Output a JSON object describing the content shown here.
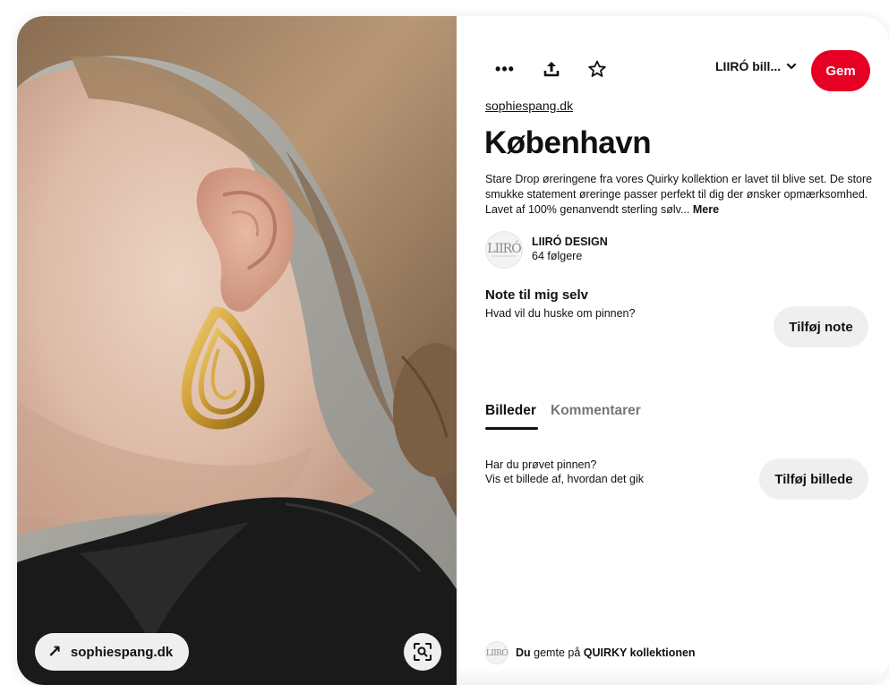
{
  "pin_image": {
    "source_pill_label": "sophiespang.dk",
    "source_pill_icon": "arrow-up-right-icon",
    "lens_icon": "visual-search-icon"
  },
  "toolbar": {
    "more_icon": "more-icon",
    "share_icon": "share-icon",
    "favorite_icon": "star-icon",
    "board_name": "LIIRÓ bill...",
    "board_chevron_icon": "chevron-down-icon",
    "save_label": "Gem",
    "save_color": "#e60023"
  },
  "pin": {
    "source_link": "sophiespang.dk",
    "title": "København",
    "description": "Stare Drop øreringene fra vores Quirky kollektion er lavet til blive set. De store smukke statement øreringe passer perfekt til dig der ønsker opmærksomhed. Lavet af 100% genanvendt sterling sølv...",
    "more_label": "Mere"
  },
  "creator": {
    "name": "LIIRÓ DESIGN",
    "followers": "64 følgere"
  },
  "note": {
    "title": "Note til mig selv",
    "prompt": "Hvad vil du huske om pinnen?",
    "add_label": "Tilføj note"
  },
  "tabs": [
    {
      "label": "Billeder",
      "active": true
    },
    {
      "label": "Kommentarer",
      "active": false
    }
  ],
  "tried": {
    "question": "Har du prøvet pinnen?",
    "subtext": "Vis et billede af, hvordan det gik",
    "add_label": "Tilføj billede"
  },
  "saved": {
    "actor": "Du",
    "verb": "gemte på",
    "board": "QUIRKY kollektionen"
  }
}
